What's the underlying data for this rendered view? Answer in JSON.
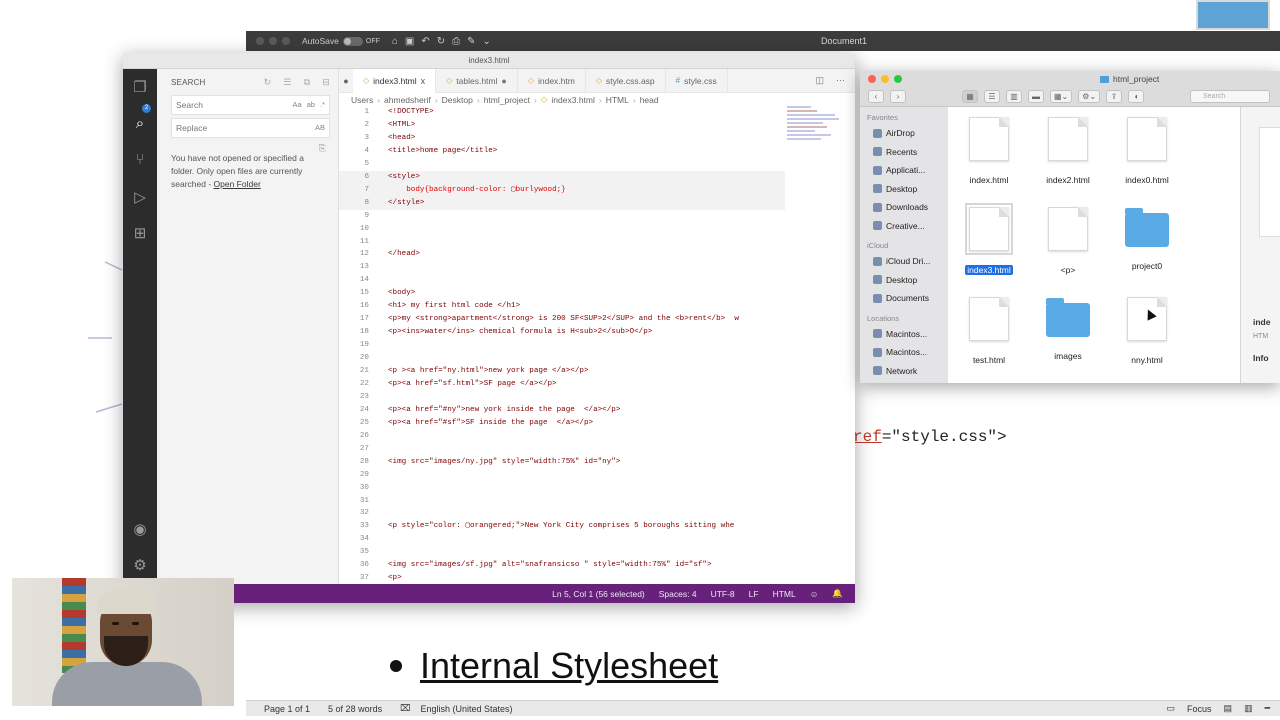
{
  "word": {
    "autosave_label": "AutoSave",
    "autosave_state": "OFF",
    "document_title": "Document1",
    "code_fragment_attr": "ref",
    "code_fragment_rest": "=\"style.css\">",
    "bullet_text": "Internal Stylesheet",
    "status": {
      "page": "Page 1 of 1",
      "words": "5 of 28 words",
      "language": "English (United States)",
      "focus": "Focus"
    }
  },
  "vscode": {
    "window_title": "index3.html",
    "sidebar": {
      "heading": "SEARCH",
      "search_placeholder": "Search",
      "search_options": "Aa",
      "replace_placeholder": "Replace",
      "replace_options": "AB",
      "message": "You have not opened or specified a folder. Only open files are currently searched - ",
      "open_folder_link": "Open Folder"
    },
    "tabs": [
      {
        "label": "index3.html",
        "active": true,
        "marker": "x"
      },
      {
        "label": "tables.html",
        "active": false,
        "marker": "●"
      },
      {
        "label": "index.htm",
        "active": false,
        "marker": ""
      },
      {
        "label": "style.css.asp",
        "active": false,
        "marker": ""
      },
      {
        "label": "style.css",
        "active": false,
        "marker": ""
      }
    ],
    "breadcrumb": [
      "Users",
      "ahmedsherif",
      "Desktop",
      "html_project",
      "index3.html",
      "HTML",
      "head"
    ],
    "code_lines": [
      {
        "n": "1",
        "text": "<!DOCTYPE>"
      },
      {
        "n": "2",
        "text": "<HTML>"
      },
      {
        "n": "3",
        "text": "<head>"
      },
      {
        "n": "4",
        "text": "<title>home page</title>"
      },
      {
        "n": "5",
        "text": ""
      },
      {
        "n": "6",
        "text": "<style>"
      },
      {
        "n": "7",
        "text": "    body{background-color: ▢burlywood;}"
      },
      {
        "n": "8",
        "text": "</style>"
      },
      {
        "n": "9",
        "text": ""
      },
      {
        "n": "10",
        "text": ""
      },
      {
        "n": "11",
        "text": ""
      },
      {
        "n": "12",
        "text": "</head>"
      },
      {
        "n": "13",
        "text": ""
      },
      {
        "n": "14",
        "text": ""
      },
      {
        "n": "15",
        "text": "<body>"
      },
      {
        "n": "16",
        "text": "<h1> my first html code </h1>"
      },
      {
        "n": "17",
        "text": "<p>my <strong>apartment</strong> is 200 SF<SUP>2</SUP> and the <b>rent</b>  w"
      },
      {
        "n": "18",
        "text": "<p><ins>water</ins> chemical formula is H<sub>2</sub>O</p>"
      },
      {
        "n": "19",
        "text": ""
      },
      {
        "n": "20",
        "text": ""
      },
      {
        "n": "21",
        "text": "<p ><a href=\"ny.html\">new york page </a></p>"
      },
      {
        "n": "22",
        "text": "<p><a href=\"sf.html\">SF page </a></p>"
      },
      {
        "n": "23",
        "text": ""
      },
      {
        "n": "24",
        "text": "<p><a href=\"#ny\">new york inside the page  </a></p>"
      },
      {
        "n": "25",
        "text": "<p><a href=\"#sf\">SF inside the page  </a></p>"
      },
      {
        "n": "26",
        "text": ""
      },
      {
        "n": "27",
        "text": ""
      },
      {
        "n": "28",
        "text": "<img src=\"images/ny.jpg\" style=\"width:75%\" id=\"ny\">"
      },
      {
        "n": "29",
        "text": ""
      },
      {
        "n": "30",
        "text": ""
      },
      {
        "n": "31",
        "text": ""
      },
      {
        "n": "32",
        "text": ""
      },
      {
        "n": "33",
        "text": "<p style=\"color: ▢orangered;\">New York City comprises 5 boroughs sitting whe"
      },
      {
        "n": "34",
        "text": ""
      },
      {
        "n": "35",
        "text": ""
      },
      {
        "n": "36",
        "text": "<img src=\"images/sf.jpg\" alt=\"snafransicso \" style=\"width:75%\" id=\"sf\">"
      },
      {
        "n": "37",
        "text": "<p>"
      }
    ],
    "status_bar": {
      "position": "Ln 5, Col 1 (56 selected)",
      "spaces": "Spaces: 4",
      "encoding": "UTF-8",
      "eol": "LF",
      "language": "HTML"
    },
    "colors": {
      "statusbar": "#68217a",
      "activity": "#2c2c2c",
      "burlywood": "#deb887",
      "orangered": "#ff4500"
    }
  },
  "finder": {
    "title": "html_project",
    "search_placeholder": "Search",
    "sidebar": {
      "favorites_heading": "Favorites",
      "favorites": [
        "AirDrop",
        "Recents",
        "Applicati...",
        "Desktop",
        "Downloads",
        "Creative..."
      ],
      "icloud_heading": "iCloud",
      "icloud": [
        "iCloud Dri...",
        "Desktop",
        "Documents"
      ],
      "locations_heading": "Locations",
      "locations": [
        "Macintos...",
        "Macintos...",
        "Network"
      ]
    },
    "items": [
      {
        "name": "index.html",
        "kind": "doc",
        "selected": false
      },
      {
        "name": "index2.html",
        "kind": "doc",
        "selected": false
      },
      {
        "name": "index0.html",
        "kind": "doc",
        "selected": false
      },
      {
        "name": "index3.html",
        "kind": "doc",
        "selected": true
      },
      {
        "name": "<p>",
        "kind": "doc",
        "selected": false
      },
      {
        "name": "project0",
        "kind": "folder",
        "selected": false
      },
      {
        "name": "test.html",
        "kind": "doc",
        "selected": false
      },
      {
        "name": "images",
        "kind": "folder",
        "selected": false
      },
      {
        "name": "nny.html",
        "kind": "doc",
        "selected": false
      }
    ],
    "preview": {
      "name": "inde",
      "type": "HTM",
      "info": "Info"
    }
  }
}
